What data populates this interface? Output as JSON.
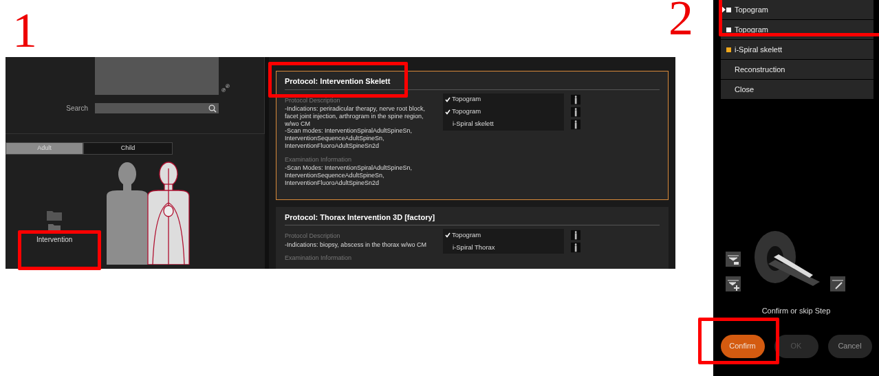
{
  "annotations": [
    {
      "label": "1"
    },
    {
      "label": "2"
    }
  ],
  "screen_1": {
    "left_panel": {
      "search": {
        "label": "Search"
      },
      "tabs": [
        {
          "label": "Adult",
          "selected": true
        },
        {
          "label": "Child",
          "selected": false
        }
      ],
      "folders": [
        {
          "label": "Intervention"
        }
      ]
    },
    "protocols": [
      {
        "title": "Protocol: Intervention Skelett",
        "selected": true,
        "sections": [
          {
            "heading": "Protocol Description",
            "text": "-Indications: periradicular therapy, nerve root block, facet joint injection, arthrogram in the spine region, w/wo CM\n-Scan modes: InterventionSpiralAdultSpineSn, InterventionSequenceAdultSpineSn, InterventionFluoroAdultSpineSn2d"
          },
          {
            "heading": "Examination Information",
            "text": "-Scan Modes: InterventionSpiralAdultSpineSn, InterventionSequenceAdultSpineSn, InterventionFluoroAdultSpineSn2d"
          }
        ],
        "steps": [
          {
            "label": "Topogram",
            "checked": true
          },
          {
            "label": "Topogram",
            "checked": true
          },
          {
            "label": "i-Spiral skelett",
            "checked": false
          }
        ]
      },
      {
        "title": "Protocol: Thorax Intervention 3D [factory]",
        "selected": false,
        "sections": [
          {
            "heading": "Protocol Description",
            "text": "-Indications: biopsy, abscess in the thorax w/wo CM"
          },
          {
            "heading": "Examination Information"
          }
        ],
        "steps": [
          {
            "label": "Topogram",
            "checked": true
          },
          {
            "label": "i-Spiral Thorax",
            "checked": false
          }
        ]
      }
    ]
  },
  "screen_2": {
    "steps": [
      {
        "label": "Topogram",
        "current": true,
        "color": "#ffffff"
      },
      {
        "label": "Topogram",
        "current": false,
        "color": "#ffffff"
      },
      {
        "label": "i-Spiral skelett",
        "current": false,
        "color": "#f0a81c"
      },
      {
        "label": "Reconstruction",
        "current": false
      },
      {
        "label": "Close",
        "current": false
      }
    ],
    "message": "Confirm or skip Step",
    "buttons": [
      {
        "label": "Confirm",
        "disabled": false,
        "primary": true
      },
      {
        "label": "OK",
        "disabled": true,
        "primary": false
      },
      {
        "label": "Cancel",
        "disabled": false,
        "primary": false
      }
    ]
  }
}
